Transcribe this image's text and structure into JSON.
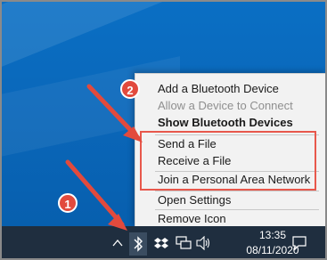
{
  "context_menu": {
    "items": [
      {
        "label": "Add a Bluetooth Device",
        "state": "normal"
      },
      {
        "label": "Allow a Device to Connect",
        "state": "disabled"
      },
      {
        "label": "Show Bluetooth Devices",
        "state": "bold"
      },
      {
        "label": "Send a File",
        "state": "normal"
      },
      {
        "label": "Receive a File",
        "state": "normal"
      },
      {
        "label": "Join a Personal Area Network",
        "state": "normal"
      },
      {
        "label": "Open Settings",
        "state": "normal"
      },
      {
        "label": "Remove Icon",
        "state": "normal"
      }
    ]
  },
  "taskbar": {
    "time": "13:35",
    "date": "08/11/2020",
    "tray_icons": [
      "chevron-up-icon",
      "bluetooth-icon",
      "dropbox-icon",
      "network-icon",
      "volume-icon",
      "notification-icon"
    ]
  },
  "annotations": {
    "badge_1": "1",
    "badge_2": "2",
    "accent_color": "#e24a3d",
    "highlight_color": "#e8584c"
  },
  "colors": {
    "desktop": "#0a6fc4",
    "taskbar": "#1f2e3f",
    "menu_bg": "#f2f2f2",
    "disabled_text": "#8f8f8f"
  }
}
